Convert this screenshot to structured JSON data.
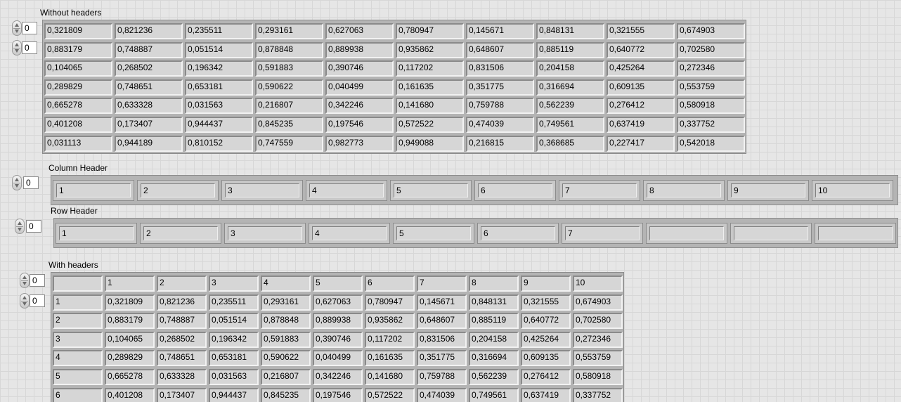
{
  "without_headers": {
    "label": "Without headers",
    "row_index": "0",
    "col_index": "0",
    "rows": [
      [
        "0,321809",
        "0,821236",
        "0,235511",
        "0,293161",
        "0,627063",
        "0,780947",
        "0,145671",
        "0,848131",
        "0,321555",
        "0,674903"
      ],
      [
        "0,883179",
        "0,748887",
        "0,051514",
        "0,878848",
        "0,889938",
        "0,935862",
        "0,648607",
        "0,885119",
        "0,640772",
        "0,702580"
      ],
      [
        "0,104065",
        "0,268502",
        "0,196342",
        "0,591883",
        "0,390746",
        "0,117202",
        "0,831506",
        "0,204158",
        "0,425264",
        "0,272346"
      ],
      [
        "0,289829",
        "0,748651",
        "0,653181",
        "0,590622",
        "0,040499",
        "0,161635",
        "0,351775",
        "0,316694",
        "0,609135",
        "0,553759"
      ],
      [
        "0,665278",
        "0,633328",
        "0,031563",
        "0,216807",
        "0,342246",
        "0,141680",
        "0,759788",
        "0,562239",
        "0,276412",
        "0,580918"
      ],
      [
        "0,401208",
        "0,173407",
        "0,944437",
        "0,845235",
        "0,197546",
        "0,572522",
        "0,474039",
        "0,749561",
        "0,637419",
        "0,337752"
      ],
      [
        "0,031113",
        "0,944189",
        "0,810152",
        "0,747559",
        "0,982773",
        "0,949088",
        "0,216815",
        "0,368685",
        "0,227417",
        "0,542018"
      ]
    ]
  },
  "column_header": {
    "label": "Column Header",
    "index": "0",
    "values": [
      "1",
      "2",
      "3",
      "4",
      "5",
      "6",
      "7",
      "8",
      "9",
      "10"
    ]
  },
  "row_header": {
    "label": "Row Header",
    "index": "0",
    "values": [
      "1",
      "2",
      "3",
      "4",
      "5",
      "6",
      "7",
      "",
      "",
      ""
    ]
  },
  "with_headers": {
    "label": "With headers",
    "row_index": "0",
    "col_index": "0",
    "corner": "",
    "col_headers": [
      "1",
      "2",
      "3",
      "4",
      "5",
      "6",
      "7",
      "8",
      "9",
      "10"
    ],
    "row_headers": [
      "1",
      "2",
      "3",
      "4",
      "5",
      "6"
    ],
    "rows": [
      [
        "0,321809",
        "0,821236",
        "0,235511",
        "0,293161",
        "0,627063",
        "0,780947",
        "0,145671",
        "0,848131",
        "0,321555",
        "0,674903"
      ],
      [
        "0,883179",
        "0,748887",
        "0,051514",
        "0,878848",
        "0,889938",
        "0,935862",
        "0,648607",
        "0,885119",
        "0,640772",
        "0,702580"
      ],
      [
        "0,104065",
        "0,268502",
        "0,196342",
        "0,591883",
        "0,390746",
        "0,117202",
        "0,831506",
        "0,204158",
        "0,425264",
        "0,272346"
      ],
      [
        "0,289829",
        "0,748651",
        "0,653181",
        "0,590622",
        "0,040499",
        "0,161635",
        "0,351775",
        "0,316694",
        "0,609135",
        "0,553759"
      ],
      [
        "0,665278",
        "0,633328",
        "0,031563",
        "0,216807",
        "0,342246",
        "0,141680",
        "0,759788",
        "0,562239",
        "0,276412",
        "0,580918"
      ],
      [
        "0,401208",
        "0,173407",
        "0,944437",
        "0,845235",
        "0,197546",
        "0,572522",
        "0,474039",
        "0,749561",
        "0,637419",
        "0,337752"
      ]
    ]
  }
}
